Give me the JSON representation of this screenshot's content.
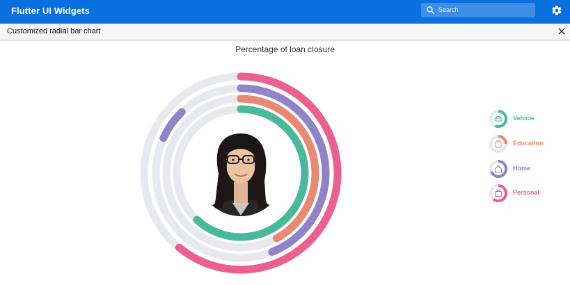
{
  "app": {
    "title": "Flutter UI Widgets"
  },
  "search": {
    "placeholder": "Search"
  },
  "subheader": {
    "title": "Customized radial bar chart"
  },
  "colors": {
    "appbar": "#0a6fdf",
    "track": "#e8e8ef",
    "vehicle": "#48b99b",
    "education": "#e88a71",
    "home": "#9083c9",
    "personal": "#ec5f8e"
  },
  "chart_data": {
    "type": "radial_bar",
    "title": "Percentage of loan closure",
    "series": [
      {
        "name": "Vehicle",
        "value": 62,
        "color": "#48b99b",
        "icon": "car-icon"
      },
      {
        "name": "Education",
        "value": 42,
        "color": "#e88a71",
        "icon": "school-bag-icon"
      },
      {
        "name": "Home",
        "value": 44,
        "color": "#9083c9",
        "icon": "house-icon"
      },
      {
        "name": "Personal",
        "value": 61,
        "color": "#ec5f8e",
        "icon": "briefcase-icon"
      }
    ],
    "extra_arcs": [
      {
        "color": "#9083c9",
        "value": 11
      }
    ],
    "center": "person-photo"
  }
}
